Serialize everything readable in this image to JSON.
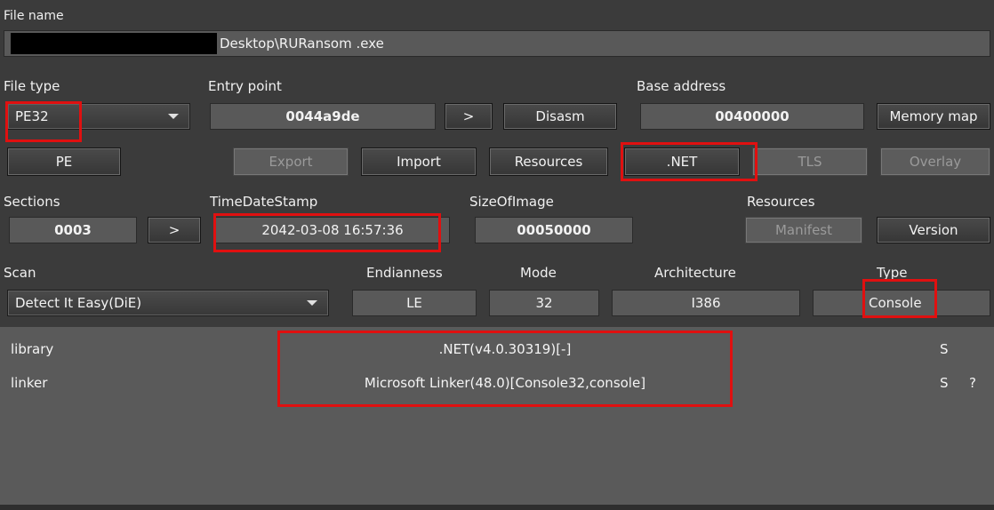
{
  "file": {
    "label": "File name",
    "path": "Desktop\\RURansom .exe"
  },
  "file_type": {
    "label": "File type",
    "value": "PE32"
  },
  "entry_point": {
    "label": "Entry point",
    "value": "0044a9de",
    "arrow": ">",
    "disasm": "Disasm"
  },
  "base_address": {
    "label": "Base address",
    "value": "00400000",
    "memory_map": "Memory map"
  },
  "buttons": {
    "pe": "PE",
    "export": "Export",
    "import": "Import",
    "resources": "Resources",
    "net": ".NET",
    "tls": "TLS",
    "overlay": "Overlay"
  },
  "sections": {
    "label": "Sections",
    "value": "0003",
    "arrow": ">"
  },
  "timedatestamp": {
    "label": "TimeDateStamp",
    "value": "2042-03-08 16:57:36"
  },
  "sizeofimage": {
    "label": "SizeOfImage",
    "value": "00050000"
  },
  "resources": {
    "label": "Resources",
    "manifest": "Manifest",
    "version": "Version"
  },
  "scan": {
    "label": "Scan",
    "engine": "Detect It Easy(DiE)"
  },
  "endianness": {
    "label": "Endianness",
    "value": "LE"
  },
  "mode": {
    "label": "Mode",
    "value": "32"
  },
  "architecture": {
    "label": "Architecture",
    "value": "I386"
  },
  "type": {
    "label": "Type",
    "value": "Console"
  },
  "results": [
    {
      "kind": "library",
      "name": ".NET(v4.0.30319)[-]",
      "flag": "S",
      "extra": ""
    },
    {
      "kind": "linker",
      "name": "Microsoft Linker(48.0)[Console32,console]",
      "flag": "S",
      "extra": "?"
    }
  ],
  "colors": {
    "highlight": "#e01010",
    "panel": "#3b3b3b",
    "results_bg": "#5a5a5a"
  }
}
